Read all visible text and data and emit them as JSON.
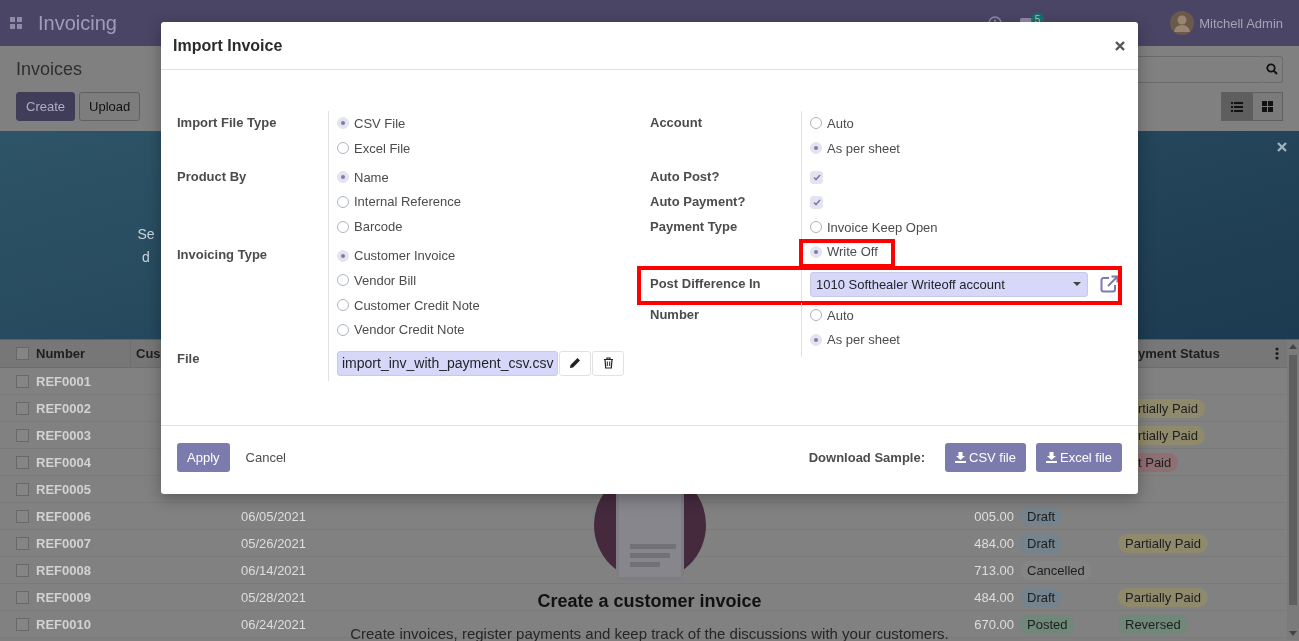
{
  "navbar": {
    "app_title": "Invoicing",
    "message_count": "5",
    "user": "Mitchell Admin"
  },
  "control_panel": {
    "title": "Invoices",
    "buttons": [
      "Create",
      "Upload"
    ],
    "views": [
      {
        "kind": "list",
        "selected": true
      },
      {
        "kind": "kanban",
        "selected": false
      }
    ]
  },
  "banner": {
    "text_fragments": [
      "Se",
      "d"
    ]
  },
  "list": {
    "columns": [
      "Number",
      "Cus",
      "yment Status"
    ],
    "all_checked": false,
    "rows": [
      {
        "number": "REF0001",
        "checked": false
      },
      {
        "number": "REF0002",
        "checked": false,
        "payment": {
          "text": "rtially Paid",
          "color": "#8f8a6c"
        }
      },
      {
        "number": "REF0003",
        "checked": false,
        "payment": {
          "text": "rtially Paid",
          "color": "#8f8a6c"
        }
      },
      {
        "number": "REF0004",
        "checked": false,
        "payment": {
          "text": "t Paid",
          "color": "#8f6f72"
        }
      },
      {
        "number": "REF0005",
        "checked": false
      },
      {
        "number": "REF0006",
        "checked": false,
        "date": "06/05/2021",
        "amount": "005.00",
        "status": {
          "text": "Draft",
          "color": "#74838d"
        }
      },
      {
        "number": "REF0007",
        "checked": false,
        "date": "05/26/2021",
        "amount": "484.00",
        "status": {
          "text": "Draft",
          "color": "#74838d"
        },
        "payment": {
          "text": "Partially Paid",
          "color": "#8f8a6c"
        }
      },
      {
        "number": "REF0008",
        "checked": false,
        "date": "06/14/2021",
        "amount": "713.00",
        "status": {
          "text": "Cancelled",
          "color": "#858585"
        }
      },
      {
        "number": "REF0009",
        "checked": false,
        "date": "05/28/2021",
        "amount": "484.00",
        "status": {
          "text": "Draft",
          "color": "#74838d"
        },
        "payment": {
          "text": "Partially Paid",
          "color": "#8f8a6c"
        }
      },
      {
        "number": "REF0010",
        "checked": false,
        "date": "06/24/2021",
        "amount": "670.00",
        "status": {
          "text": "Posted",
          "color": "#6f8878"
        },
        "payment": {
          "text": "Reversed",
          "color": "#6f8878"
        }
      }
    ]
  },
  "empty_help": {
    "title": "Create a customer invoice",
    "text": "Create invoices, register payments and keep track of the discussions with your customers."
  },
  "dialog": {
    "title": "Import Invoice",
    "left_fields": [
      {
        "label": "Import File Type",
        "kind": "radio",
        "highlighted": false,
        "options": [
          {
            "label": "CSV File",
            "selected": true
          },
          {
            "label": "Excel File",
            "selected": false
          }
        ]
      },
      {
        "label": "Product By",
        "kind": "radio",
        "highlighted": false,
        "options": [
          {
            "label": "Name",
            "selected": true
          },
          {
            "label": "Internal Reference",
            "selected": false
          },
          {
            "label": "Barcode",
            "selected": false
          }
        ]
      },
      {
        "label": "Invoicing Type",
        "kind": "radio",
        "highlighted": false,
        "options": [
          {
            "label": "Customer Invoice",
            "selected": true
          },
          {
            "label": "Vendor Bill",
            "selected": false
          },
          {
            "label": "Customer Credit Note",
            "selected": false
          },
          {
            "label": "Vendor Credit Note",
            "selected": false
          }
        ]
      },
      {
        "label": "File",
        "kind": "file",
        "highlighted": false,
        "value": "import_inv_with_payment_csv.csv"
      }
    ],
    "right_fields": [
      {
        "label": "Account",
        "kind": "radio",
        "highlighted": false,
        "options": [
          {
            "label": "Auto",
            "selected": false
          },
          {
            "label": "As per sheet",
            "selected": true
          }
        ]
      },
      {
        "label": "Auto Post?",
        "kind": "checkbox",
        "highlighted": false,
        "checked": true
      },
      {
        "label": "Auto Payment?",
        "kind": "checkbox",
        "highlighted": false,
        "checked": true
      },
      {
        "label": "Payment Type",
        "kind": "radio",
        "highlighted": false,
        "options": [
          {
            "label": "Invoice Keep Open",
            "selected": false,
            "highlighted": false
          },
          {
            "label": "Write Off",
            "selected": true,
            "highlighted": true
          }
        ]
      },
      {
        "label": "Post Difference In",
        "kind": "select",
        "highlighted": true,
        "value": "1010 Softhealer Writeoff account"
      },
      {
        "label": "Number",
        "kind": "radio",
        "highlighted": false,
        "options": [
          {
            "label": "Auto",
            "selected": false
          },
          {
            "label": "As per sheet",
            "selected": true
          }
        ]
      }
    ],
    "footer": {
      "primary": "Apply",
      "secondary": "Cancel",
      "sample_label": "Download Sample:",
      "sample_buttons": [
        "CSV file",
        "Excel file"
      ]
    }
  }
}
